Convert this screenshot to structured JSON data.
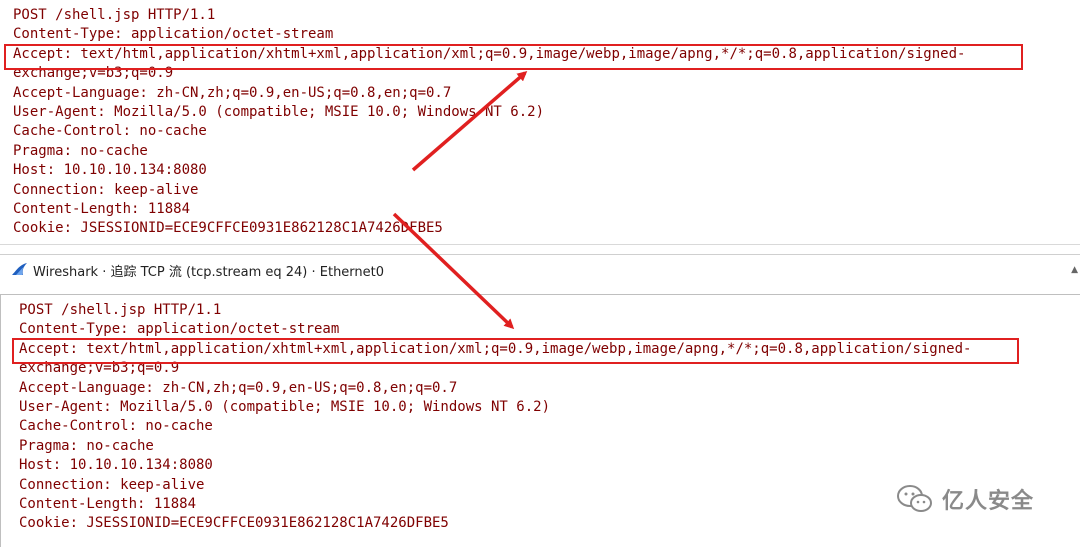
{
  "top_stream": {
    "lines": [
      "POST /shell.jsp HTTP/1.1",
      "Content-Type: application/octet-stream",
      "Accept: text/html,application/xhtml+xml,application/xml;q=0.9,image/webp,image/apng,*/*;q=0.8,application/signed-",
      "exchange;v=b3;q=0.9",
      "Accept-Language: zh-CN,zh;q=0.9,en-US;q=0.8,en;q=0.7",
      "User-Agent: Mozilla/5.0 (compatible; MSIE 10.0; Windows NT 6.2)",
      "Cache-Control: no-cache",
      "Pragma: no-cache",
      "Host: 10.10.10.134:8080",
      "Connection: keep-alive",
      "Content-Length: 11884",
      "Cookie: JSESSIONID=ECE9CFFCE0931E862128C1A7426DFBE5"
    ]
  },
  "window": {
    "title": "Wireshark · 追踪 TCP 流 (tcp.stream eq 24) · Ethernet0",
    "icon": "wireshark-fin-icon"
  },
  "bottom_stream": {
    "lines": [
      "POST /shell.jsp HTTP/1.1",
      "Content-Type: application/octet-stream",
      "Accept: text/html,application/xhtml+xml,application/xml;q=0.9,image/webp,image/apng,*/*;q=0.8,application/signed-",
      "exchange;v=b3;q=0.9",
      "Accept-Language: zh-CN,zh;q=0.9,en-US;q=0.8,en;q=0.7",
      "User-Agent: Mozilla/5.0 (compatible; MSIE 10.0; Windows NT 6.2)",
      "Cache-Control: no-cache",
      "Pragma: no-cache",
      "Host: 10.10.10.134:8080",
      "Connection: keep-alive",
      "Content-Length: 11884",
      "Cookie: JSESSIONID=ECE9CFFCE0931E862128C1A7426DFBE5"
    ]
  },
  "watermark": {
    "text": "亿人安全",
    "icon": "wechat-icon"
  },
  "colors": {
    "stream_text": "#7f0000",
    "highlight": "#e02020",
    "watermark": "#8a8a8a"
  }
}
